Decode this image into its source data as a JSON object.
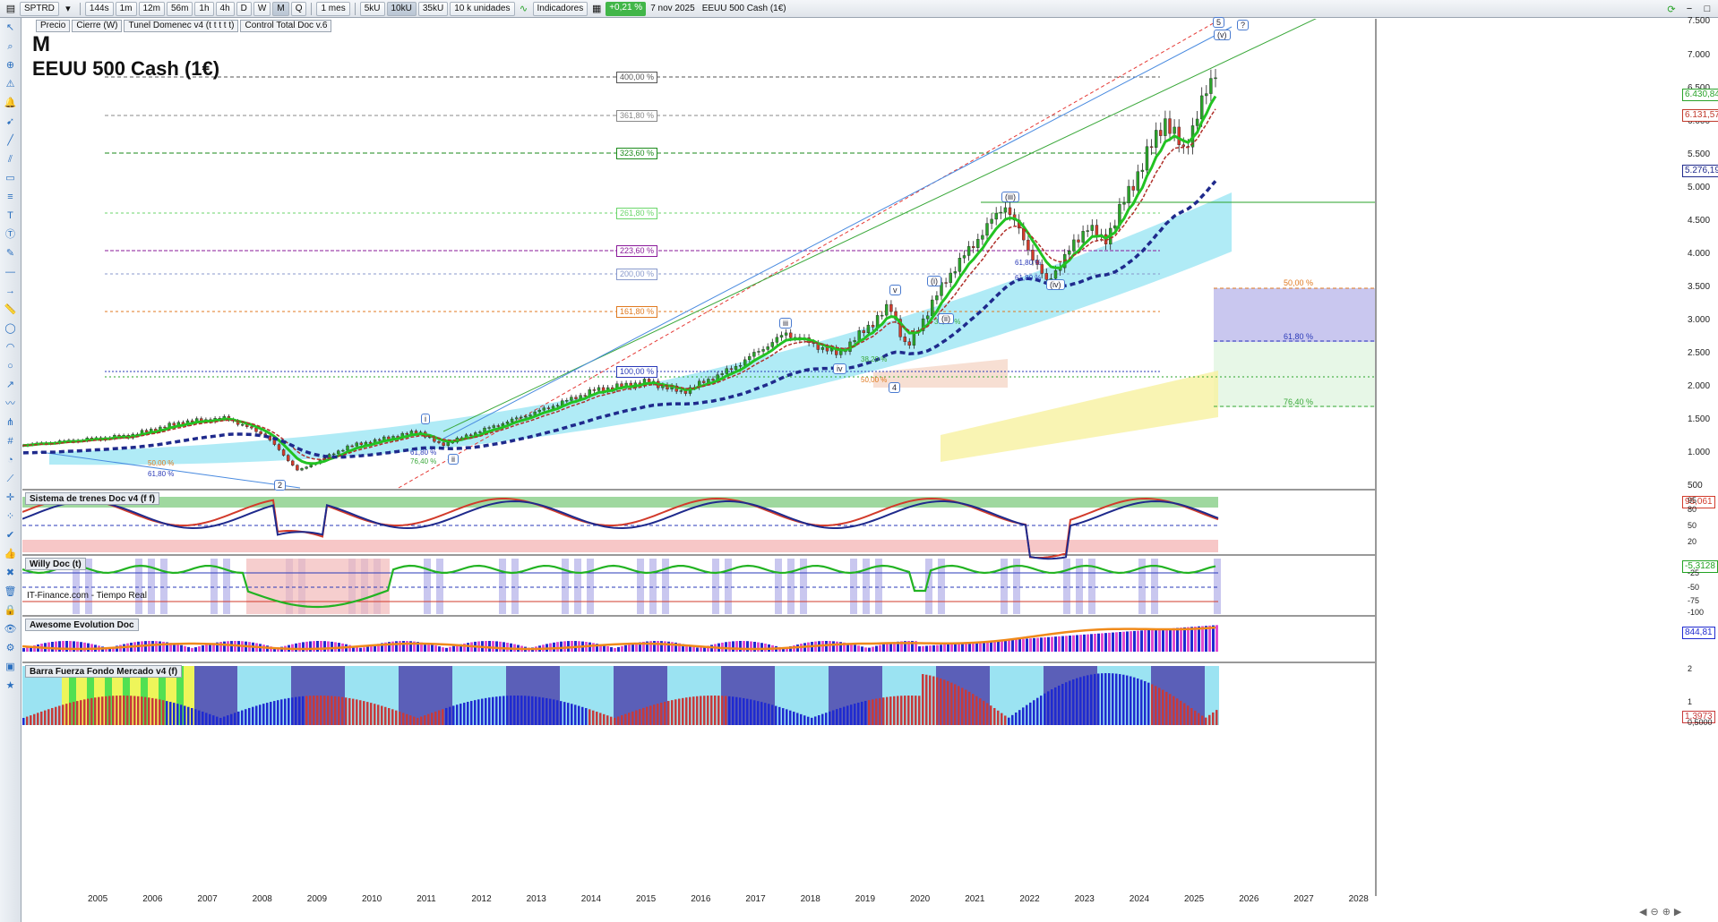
{
  "toolbar": {
    "symbol": "SPTRD",
    "timeframes": [
      "144s",
      "1m",
      "12m",
      "56m",
      "1h",
      "4h",
      "D",
      "W",
      "M",
      "Q"
    ],
    "active_timeframe": "M",
    "period": "1 mes",
    "volumes": [
      "5kU",
      "10kU",
      "35kU"
    ],
    "active_volume": "10kU",
    "units": "10 k unidades",
    "indicators_label": "Indicadores",
    "change": "+0,21 %",
    "date": "7 nov 2025",
    "instrument": "EEUU 500 Cash (1€)"
  },
  "chart_tabs": [
    "Precio",
    "Cierre (W)",
    "Tunel Domenec v4 (t t t t t)",
    "Control Total Doc v.6"
  ],
  "chart": {
    "period_letter": "M",
    "title": "EEUU 500 Cash (1€)",
    "source": "IT-Finance.com - Tiempo Real",
    "price_ticks": [
      "7.500",
      "7.000",
      "6.500",
      "6.000",
      "5.500",
      "5.000",
      "4.500",
      "4.000",
      "3.500",
      "3.000",
      "2.500",
      "2.000",
      "1.500",
      "1.000",
      "500"
    ],
    "price_badges": [
      {
        "text": "6.430,84",
        "color": "#2aa32a"
      },
      {
        "text": "6.131,57",
        "color": "#c0392b"
      },
      {
        "text": "5.276,19",
        "color": "#1f2a8c"
      }
    ],
    "fib_levels": [
      {
        "text": "400,00 %",
        "color": "#555555"
      },
      {
        "text": "361,80 %",
        "color": "#888888"
      },
      {
        "text": "323,60 %",
        "color": "#1a8a1a"
      },
      {
        "text": "261,80 %",
        "color": "#6bd66b"
      },
      {
        "text": "223,60 %",
        "color": "#8a1a9a"
      },
      {
        "text": "200,00 %",
        "color": "#8899cc"
      },
      {
        "text": "161,80 %",
        "color": "#e07a20"
      },
      {
        "text": "100,00 %",
        "color": "#2a3ab8"
      }
    ],
    "retracements": [
      {
        "text": "50,00 %",
        "color": "#e07a20"
      },
      {
        "text": "61,80 %",
        "color": "#2a3ab8"
      },
      {
        "text": "76,40 %",
        "color": "#3aa83a"
      }
    ],
    "small_fibs": [
      "50,00 %",
      "61,80 %",
      "61,80 %",
      "76,40 %",
      "38,20 %",
      "50,00 %",
      "61,80 %",
      "61,80 %",
      "38,20 %"
    ],
    "wave_labels": [
      "i",
      "ii",
      "iii",
      "iv",
      "v",
      "(i)",
      "(ii)",
      "(iii)",
      "(iv)",
      "(v)",
      "2",
      "4",
      "5",
      "?"
    ],
    "years": [
      "2005",
      "2006",
      "2007",
      "2008",
      "2009",
      "2010",
      "2011",
      "2012",
      "2013",
      "2014",
      "2015",
      "2016",
      "2017",
      "2018",
      "2019",
      "2020",
      "2021",
      "2022",
      "2023",
      "2024",
      "2025",
      "2026",
      "2027",
      "2028"
    ]
  },
  "panels": [
    {
      "title": "Sistema de trenes Doc v4 (f f)",
      "value": "95,061",
      "ticks": [
        "95",
        "80",
        "50",
        "20"
      ]
    },
    {
      "title": "Willy Doc (t)",
      "value": "-5,3128",
      "ticks": [
        "-25",
        "-50",
        "-75",
        "-100"
      ]
    },
    {
      "title": "Awesome Evolution Doc",
      "value": "844,81",
      "ticks": []
    },
    {
      "title": "Barra Fuerza Fondo Mercado v4 (f)",
      "value": "1,3973",
      "ticks": [
        "2",
        "1",
        "0,5000"
      ]
    }
  ],
  "colors": {
    "bull": "#2aa32a",
    "bear": "#c0392b",
    "ema_fast": "#22c322",
    "ema_slow": "#1f2a8c",
    "accent_blue": "#2a6fbf"
  }
}
